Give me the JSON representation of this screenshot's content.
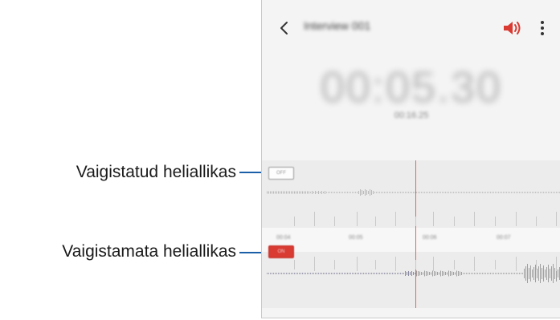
{
  "callouts": {
    "muted_source": "Vaigistatud heliallikas",
    "unmuted_source": "Vaigistamata heliallikas"
  },
  "recording": {
    "title": "Interview 001",
    "elapsed": "00:05.30",
    "sub_time": "00:16.25"
  },
  "tracks": {
    "muted_badge": "OFF",
    "active_badge": "ON"
  },
  "timeline": {
    "labels": [
      "00:04",
      "00:05",
      "00:06",
      "00:07"
    ]
  },
  "icons": {
    "back": "back-arrow-icon",
    "speaker": "speaker-icon",
    "more": "more-options-icon"
  },
  "colors": {
    "accent": "#d93a32",
    "callout_line": "#1a5fa8",
    "playhead": "#e0685e"
  }
}
